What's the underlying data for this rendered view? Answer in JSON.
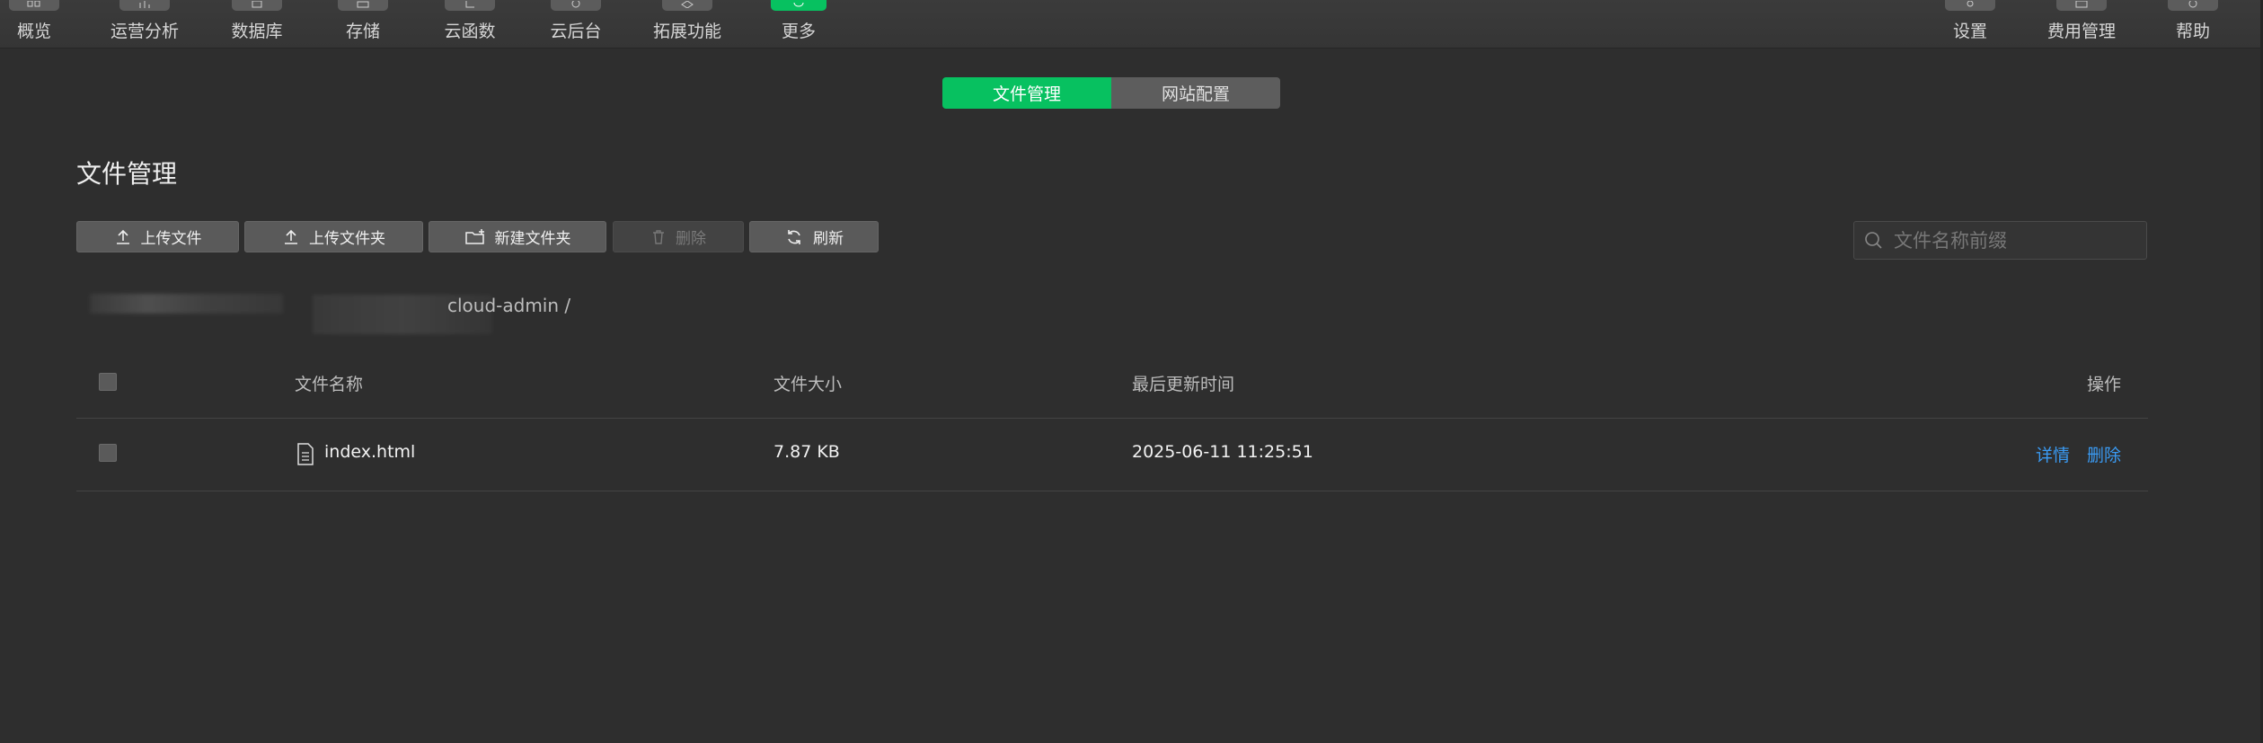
{
  "nav": {
    "left": [
      {
        "label": "概览",
        "icon": "overview-icon"
      },
      {
        "label": "运营分析",
        "icon": "analytics-icon"
      },
      {
        "label": "数据库",
        "icon": "database-icon"
      },
      {
        "label": "存储",
        "icon": "storage-icon"
      },
      {
        "label": "云函数",
        "icon": "cloud-function-icon"
      },
      {
        "label": "云后台",
        "icon": "cloud-backend-icon"
      },
      {
        "label": "拓展功能",
        "icon": "extensions-icon"
      },
      {
        "label": "更多",
        "icon": "more-icon",
        "active": true
      }
    ],
    "right": [
      {
        "label": "设置",
        "icon": "settings-icon"
      },
      {
        "label": "费用管理",
        "icon": "billing-icon"
      },
      {
        "label": "帮助",
        "icon": "help-icon"
      }
    ]
  },
  "tabs": {
    "active": "文件管理",
    "other": "网站配置"
  },
  "page": {
    "title": "文件管理"
  },
  "toolbar": {
    "upload_file": "上传文件",
    "upload_folder": "上传文件夹",
    "new_folder": "新建文件夹",
    "delete": "删除",
    "refresh": "刷新"
  },
  "search": {
    "placeholder": "文件名称前缀",
    "value": ""
  },
  "breadcrumb": {
    "path": "cloud-admin /"
  },
  "table": {
    "headers": {
      "name": "文件名称",
      "size": "文件大小",
      "updated": "最后更新时间",
      "actions": "操作"
    },
    "rows": [
      {
        "name": "index.html",
        "size": "7.87 KB",
        "updated": "2025-06-11 11:25:51",
        "action_detail": "详情",
        "action_delete": "删除"
      }
    ]
  },
  "colors": {
    "accent": "#07c160",
    "link": "#3a9bf4",
    "background": "#2e2e2e"
  }
}
